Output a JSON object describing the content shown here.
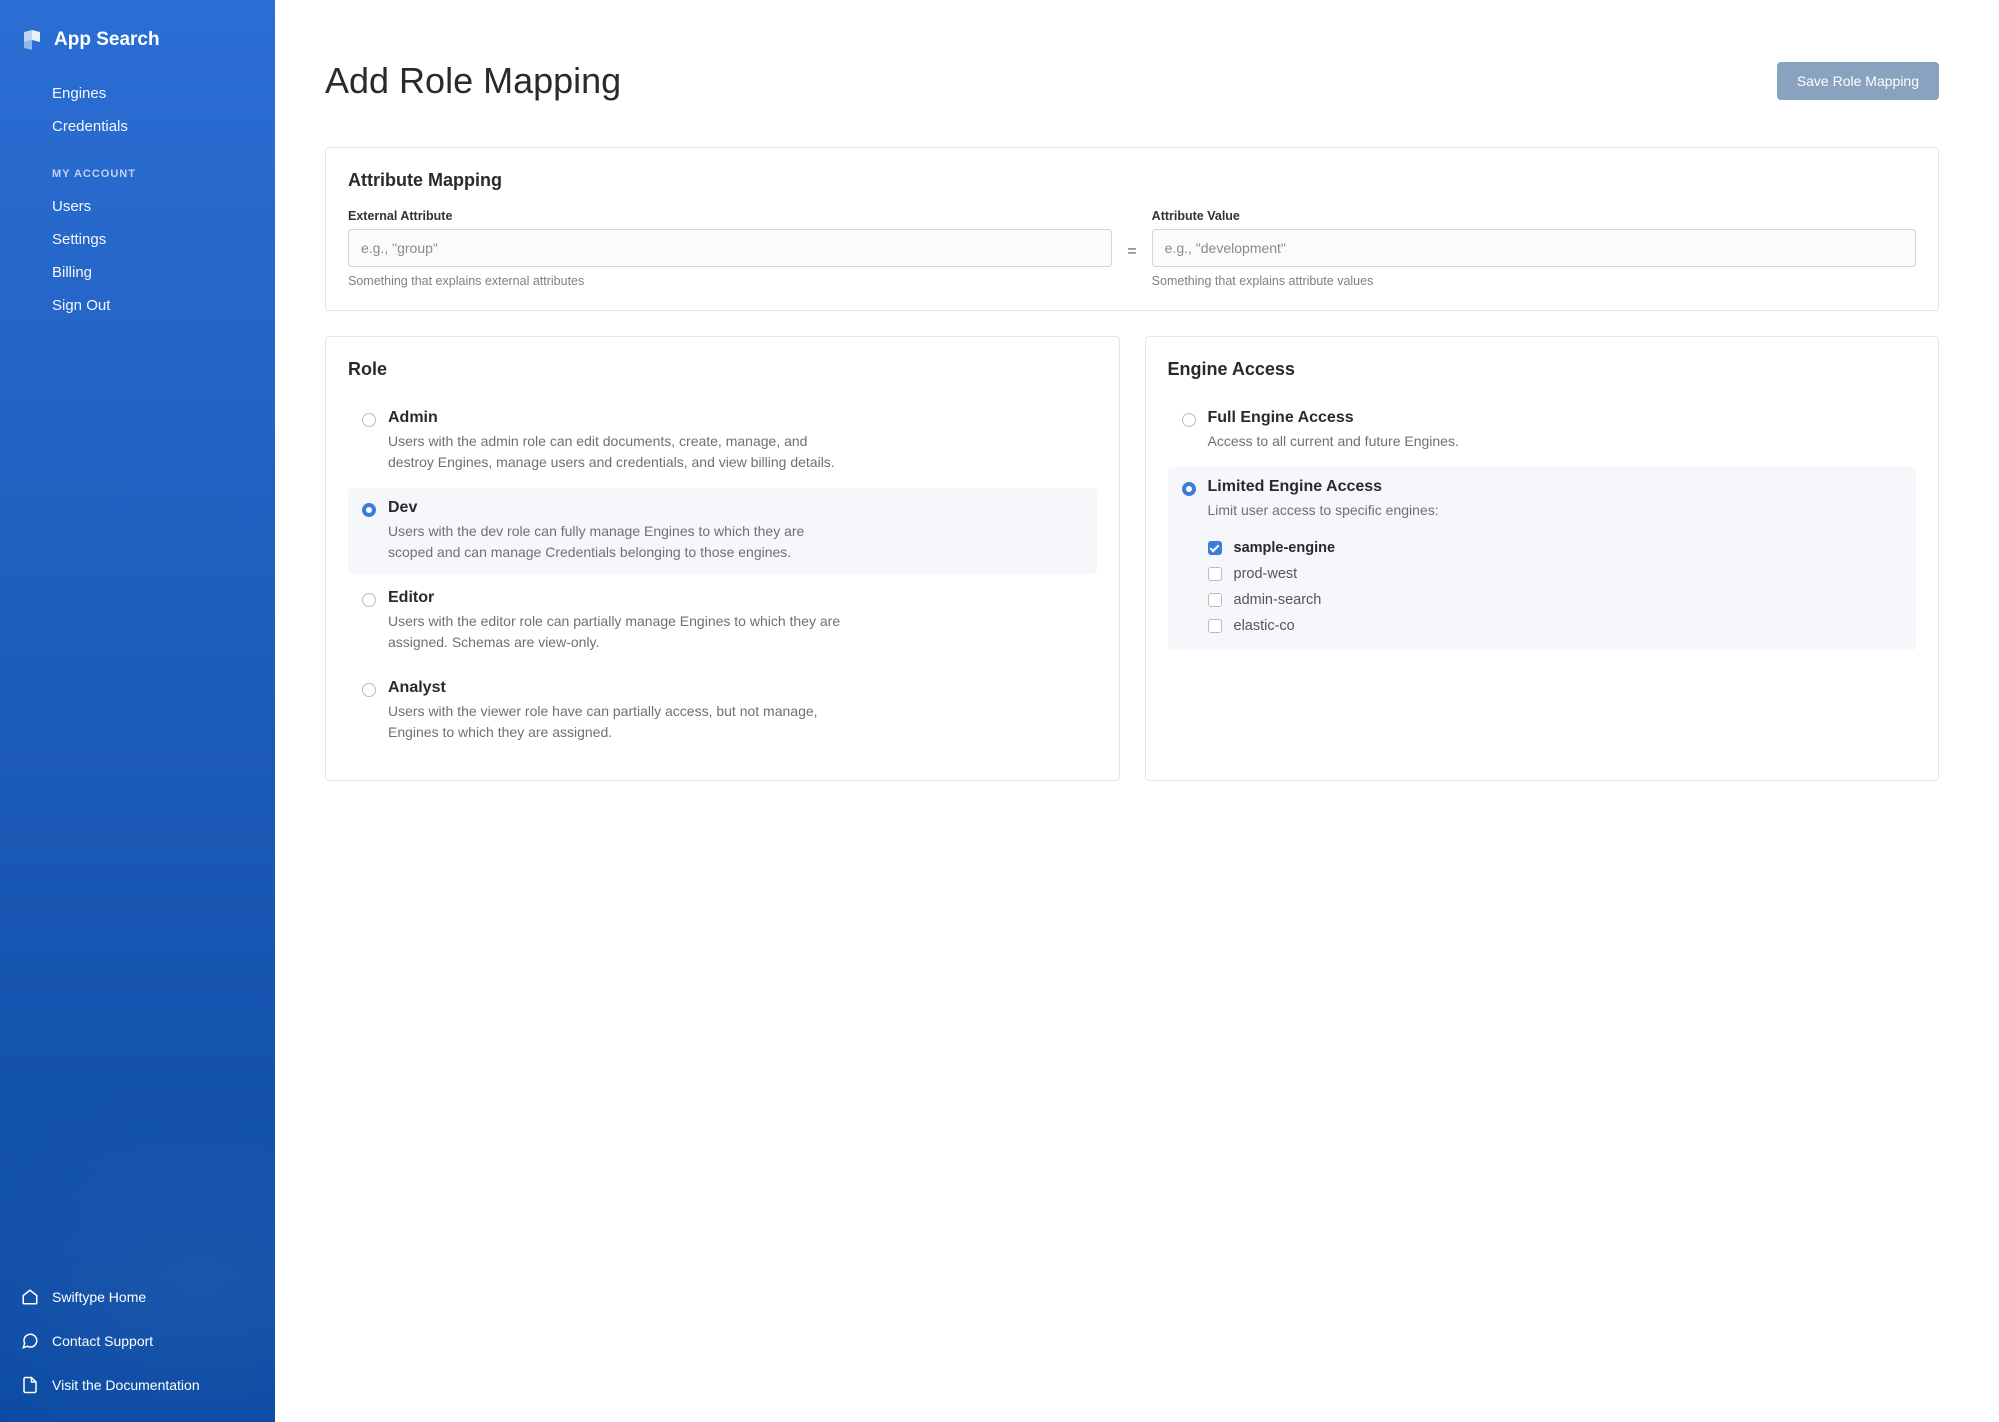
{
  "brand": {
    "name": "App Search"
  },
  "sidebar": {
    "primary": [
      {
        "label": "Engines"
      },
      {
        "label": "Credentials"
      }
    ],
    "account_header": "MY ACCOUNT",
    "account": [
      {
        "label": "Users"
      },
      {
        "label": "Settings"
      },
      {
        "label": "Billing"
      },
      {
        "label": "Sign Out"
      }
    ],
    "bottom": [
      {
        "label": "Swiftype Home"
      },
      {
        "label": "Contact Support"
      },
      {
        "label": "Visit the Documentation"
      }
    ]
  },
  "page": {
    "title": "Add Role Mapping",
    "save_button": "Save Role Mapping"
  },
  "attribute_mapping": {
    "title": "Attribute Mapping",
    "external_label": "External Attribute",
    "external_placeholder": "e.g., \"group\"",
    "external_help": "Something that explains external attributes",
    "equals": "=",
    "value_label": "Attribute Value",
    "value_placeholder": "e.g., \"development\"",
    "value_help": "Something that explains attribute values"
  },
  "roles": {
    "title": "Role",
    "options": [
      {
        "name": "Admin",
        "desc": "Users with the admin role can edit documents, create, manage, and destroy Engines, manage users and credentials, and view billing details.",
        "selected": false
      },
      {
        "name": "Dev",
        "desc": "Users with the dev role can fully manage Engines to which they are scoped and can manage Credentials belonging to those engines.",
        "selected": true
      },
      {
        "name": "Editor",
        "desc": "Users with the editor role can partially manage Engines to which they are assigned. Schemas are view-only.",
        "selected": false
      },
      {
        "name": "Analyst",
        "desc": "Users with the viewer role have can partially access, but not manage, Engines to which they are assigned.",
        "selected": false
      }
    ]
  },
  "engine_access": {
    "title": "Engine Access",
    "options": [
      {
        "name": "Full Engine Access",
        "desc": "Access to all current and future Engines.",
        "selected": false
      },
      {
        "name": "Limited Engine Access",
        "desc": "Limit user access to specific engines:",
        "selected": true
      }
    ],
    "engines": [
      {
        "name": "sample-engine",
        "checked": true
      },
      {
        "name": "prod-west",
        "checked": false
      },
      {
        "name": "admin-search",
        "checked": false
      },
      {
        "name": "elastic-co",
        "checked": false
      }
    ]
  }
}
